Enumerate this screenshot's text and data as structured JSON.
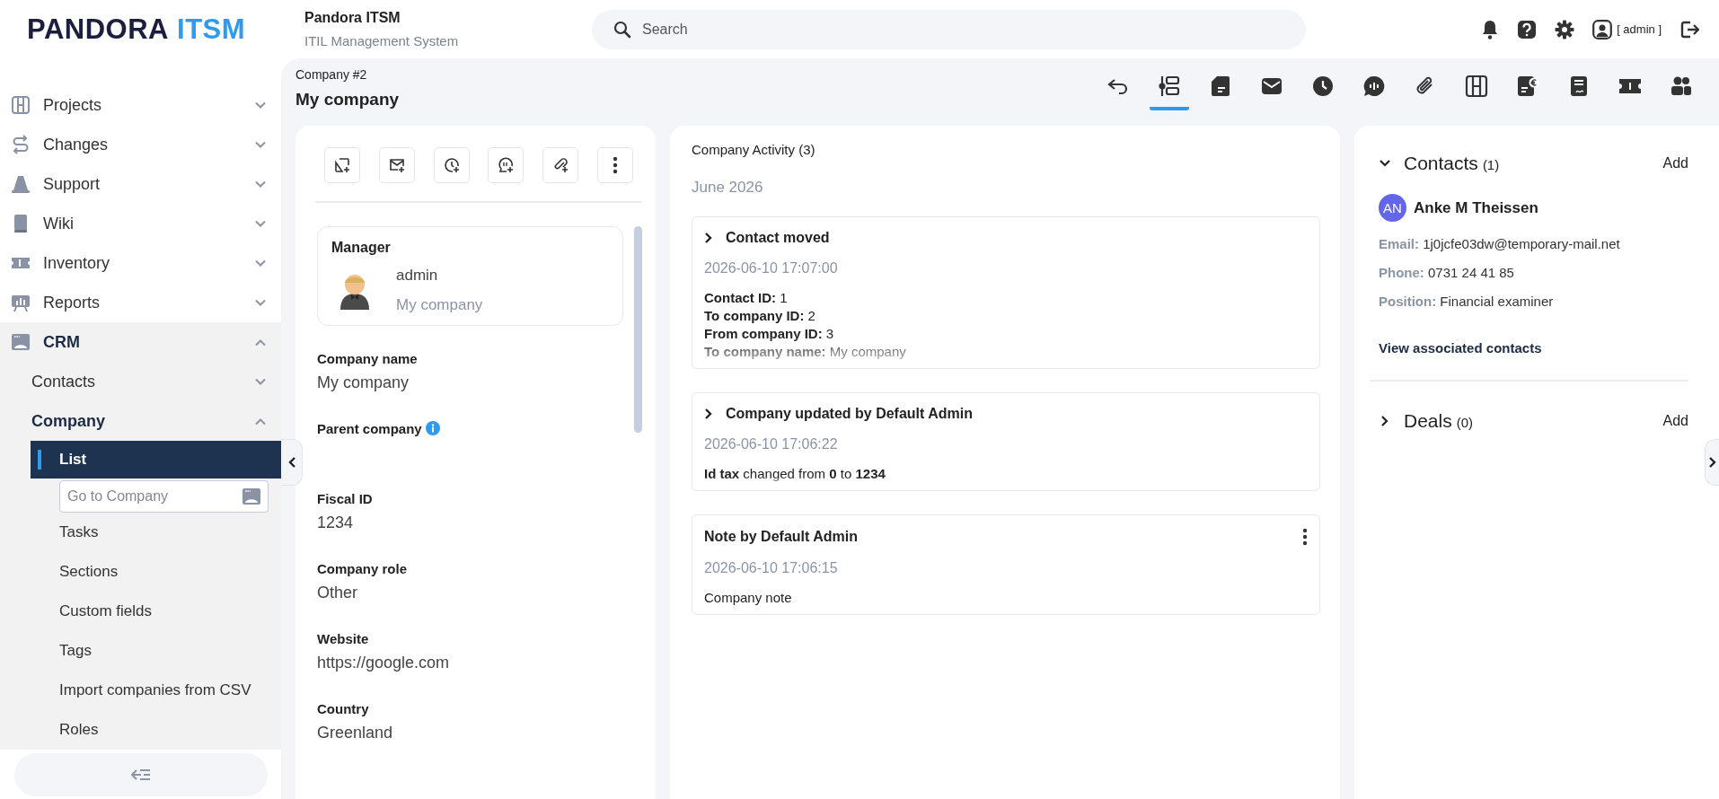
{
  "logo": {
    "brand": "PANDORA",
    "product": "ITSM"
  },
  "header": {
    "title": "Pandora ITSM",
    "subtitle": "ITIL Management System",
    "search": {
      "placeholder": "Search"
    },
    "user": "[ admin ]"
  },
  "sidebar": {
    "items": [
      {
        "label": "Projects",
        "expanded": false
      },
      {
        "label": "Changes",
        "expanded": false
      },
      {
        "label": "Support",
        "expanded": false
      },
      {
        "label": "Wiki",
        "expanded": false
      },
      {
        "label": "Inventory",
        "expanded": false
      },
      {
        "label": "Reports",
        "expanded": false
      },
      {
        "label": "CRM",
        "expanded": true,
        "children": [
          {
            "label": "Contacts",
            "expanded": false
          },
          {
            "label": "Company",
            "expanded": true,
            "children": [
              {
                "kind": "link",
                "label": "List",
                "selected": true
              },
              {
                "kind": "field",
                "placeholder": "Go to Company"
              },
              {
                "kind": "link",
                "label": "Tasks",
                "selected": false
              },
              {
                "kind": "link",
                "label": "Sections",
                "selected": false
              },
              {
                "kind": "link",
                "label": "Custom fields",
                "selected": false
              },
              {
                "kind": "link",
                "label": "Tags",
                "selected": false
              },
              {
                "kind": "link",
                "label": "Import companies from CSV",
                "selected": false
              },
              {
                "kind": "link",
                "label": "Roles",
                "selected": false
              }
            ]
          }
        ]
      }
    ]
  },
  "page": {
    "breadcrumb": "Company #2",
    "title": "My company",
    "tabs": [
      {
        "selected": false
      },
      {
        "selected": true
      },
      {
        "selected": false
      },
      {
        "selected": false
      },
      {
        "selected": false
      },
      {
        "selected": false
      },
      {
        "selected": false
      },
      {
        "selected": false
      },
      {
        "selected": false
      },
      {
        "selected": false
      },
      {
        "selected": false
      },
      {
        "selected": false
      }
    ]
  },
  "details": {
    "manager": {
      "label": "Manager",
      "name": "admin",
      "company": "My company"
    },
    "fields": [
      {
        "label": "Company name",
        "value": "My company",
        "info": false
      },
      {
        "label": "Parent company",
        "info": true
      },
      {
        "label": "Fiscal ID",
        "value": "1234",
        "info": false
      },
      {
        "label": "Company role",
        "value": "Other",
        "info": false
      },
      {
        "label": "Website",
        "value": "https://google.com",
        "info": false
      },
      {
        "label": "Country",
        "value": "Greenland",
        "info": false
      }
    ]
  },
  "activity": {
    "title": "Company Activity (3)",
    "month": "June 2026",
    "entries": [
      {
        "kind": "expandable",
        "title": "Contact moved",
        "time": "2026-06-10 17:07:00",
        "lines": [
          "**Contact ID:** 1",
          "**To company ID:** 2",
          "**From company ID:** 3",
          "**To company name:** My company"
        ]
      },
      {
        "kind": "expandable",
        "title": "Company updated by Default Admin",
        "time": "2026-06-10 17:06:22",
        "lines": [
          "**Id tax** changed from **0** to **1234**"
        ]
      },
      {
        "kind": "note",
        "title": "Note by Default Admin",
        "time": "2026-06-10 17:06:15",
        "lines": [
          "Company note"
        ]
      }
    ]
  },
  "related": {
    "sections": [
      {
        "title": "Contacts",
        "count": "(1)",
        "add": "Add",
        "expanded": true,
        "contacts": [
          {
            "initials": "AN",
            "name": "Anke M Theissen",
            "color": "#6366e8",
            "details": [
              {
                "label": "Email:",
                "value": "1j0jcfe03dw@temporary-mail.net"
              },
              {
                "label": "Phone:",
                "value": "0731 24 41 85"
              },
              {
                "label": "Position:",
                "value": "Financial examiner"
              }
            ]
          }
        ],
        "link": "View associated contacts"
      },
      {
        "title": "Deals",
        "count": "(0)",
        "add": "Add",
        "expanded": false
      }
    ]
  }
}
